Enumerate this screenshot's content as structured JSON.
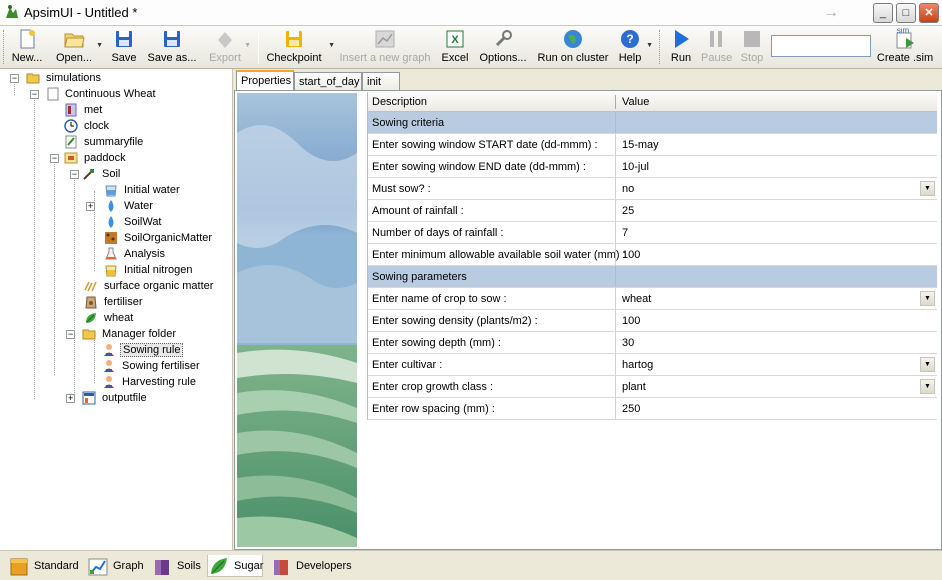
{
  "window": {
    "title": "ApsimUI - Untitled *",
    "minimize": "_",
    "maximize": "□",
    "close": "✕",
    "forward_icon": "arrow-right-icon"
  },
  "toolbar": {
    "new": "New...",
    "open": "Open...",
    "save": "Save",
    "save_as": "Save as...",
    "export": "Export",
    "checkpoint": "Checkpoint",
    "insert_graph": "Insert a new graph",
    "excel": "Excel",
    "options": "Options...",
    "run_cluster": "Run on cluster",
    "help": "Help",
    "run": "Run",
    "pause": "Pause",
    "stop": "Stop",
    "create_sim": "Create .sim",
    "sim_badge": "sim",
    "run_input_value": ""
  },
  "tree": {
    "simulations": "simulations",
    "continuous_wheat": "Continuous Wheat",
    "met": "met",
    "clock": "clock",
    "summaryfile": "summaryfile",
    "paddock": "paddock",
    "soil": "Soil",
    "initial_water": "Initial water",
    "water": "Water",
    "soilwat": "SoilWat",
    "soil_organic_matter": "SoilOrganicMatter",
    "analysis": "Analysis",
    "initial_nitrogen": "Initial nitrogen",
    "surface_organic_matter": "surface organic matter",
    "fertiliser": "fertiliser",
    "wheat": "wheat",
    "manager_folder": "Manager folder",
    "sowing_rule": "Sowing rule",
    "sowing_fertiliser": "Sowing fertiliser",
    "harvesting_rule": "Harvesting rule",
    "outputfile": "outputfile"
  },
  "tabs": [
    "Properties",
    "start_of_day",
    "init"
  ],
  "grid": {
    "header_description": "Description",
    "header_value": "Value",
    "rows": [
      {
        "description": "Sowing criteria",
        "value": "",
        "section": true
      },
      {
        "description": "Enter sowing window START date (dd-mmm) :",
        "value": "15-may"
      },
      {
        "description": "Enter sowing window END date (dd-mmm) :",
        "value": "10-jul"
      },
      {
        "description": "Must sow? :",
        "value": "no",
        "dropdown": true
      },
      {
        "description": "Amount of rainfall :",
        "value": "25"
      },
      {
        "description": "Number of days of rainfall :",
        "value": "7"
      },
      {
        "description": "Enter minimum allowable available soil water (mm) :",
        "value": "100"
      },
      {
        "description": "Sowing parameters",
        "value": "",
        "section": true
      },
      {
        "description": "Enter name of crop to sow :",
        "value": "wheat",
        "dropdown": true
      },
      {
        "description": "Enter sowing density  (plants/m2) :",
        "value": "100"
      },
      {
        "description": "Enter sowing depth  (mm) :",
        "value": "30"
      },
      {
        "description": "Enter cultivar :",
        "value": "hartog",
        "dropdown": true
      },
      {
        "description": "Enter crop growth class :",
        "value": "plant",
        "dropdown": true
      },
      {
        "description": "Enter row spacing (mm) :",
        "value": "250"
      }
    ]
  },
  "bottom_tabs": [
    "Standard",
    "Graph",
    "Soils",
    "Sugar",
    "Developers"
  ],
  "colors": {
    "section_row": "#b9cbe0",
    "active_tab_accent": "#f7a436",
    "run_blue": "#1e6fd9"
  }
}
